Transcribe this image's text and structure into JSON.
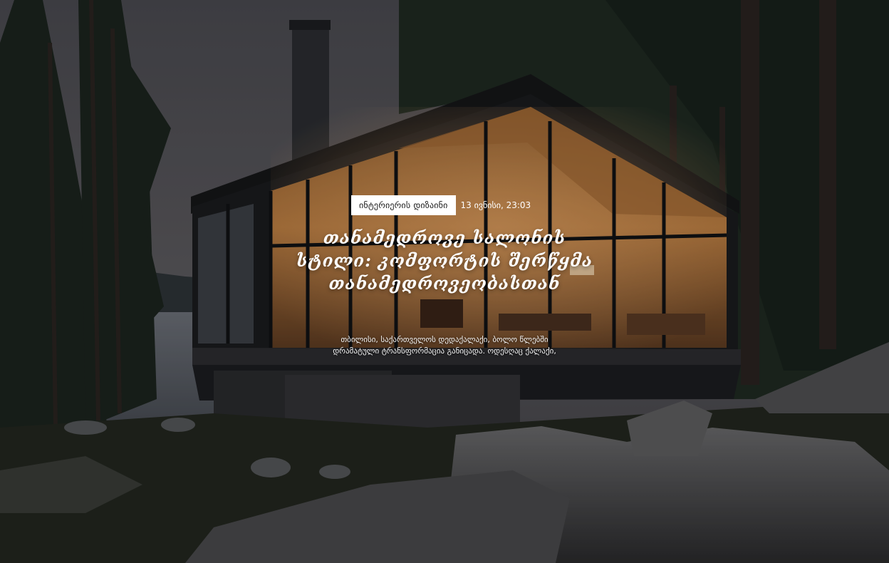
{
  "post": {
    "category": "ინტერიერის დიზაინი",
    "date": "13 ივნისი, 23:03",
    "title": "თანამედროვე სალონის სტილი: კომფორტის შერწყმა თანამედროვეობასთან",
    "excerpt": "თბილისი, საქართველოს დედაქალაქი, ბოლო წლებში დრამატული ტრანსფორმაცია განიცადა. ოდესღაც ქალაქი,"
  },
  "colors": {
    "badge_bg": "#ffffff",
    "badge_text": "#1a1a1a",
    "title_text": "#ffffff",
    "interior_glow": "#c98a4a"
  },
  "image": {
    "subject": "glass-cabin-in-forest-by-lake"
  }
}
